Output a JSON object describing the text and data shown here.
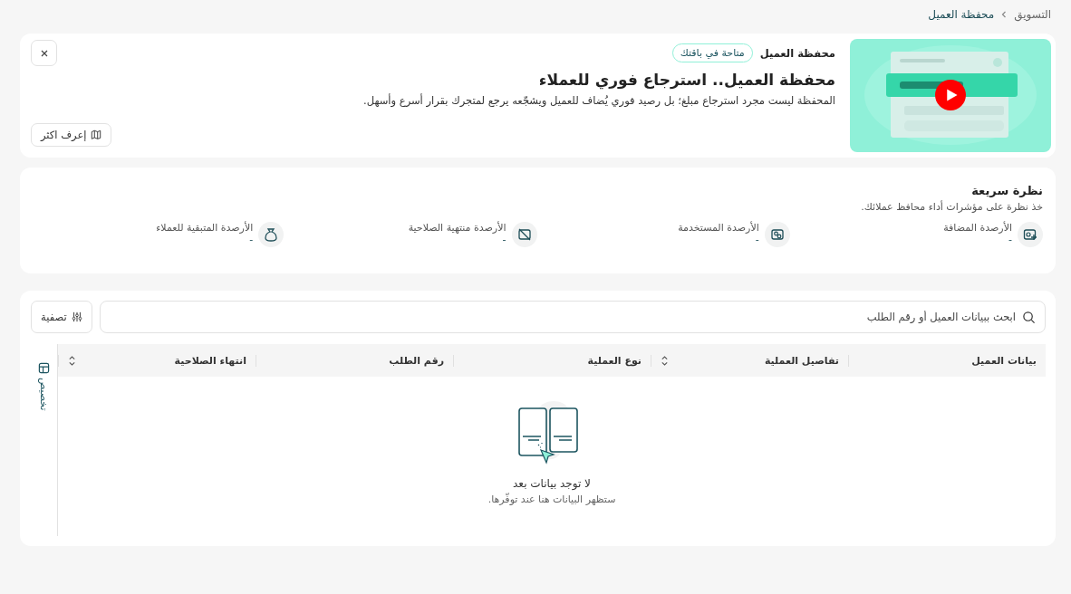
{
  "breadcrumb": [
    {
      "label": "التسويق",
      "current": false
    },
    {
      "label": "محفظة العميل",
      "current": true
    }
  ],
  "banner": {
    "kind": "picture",
    "eyebrow": "محفظة العميل",
    "badge": "متاحة في باقتك",
    "title": "محفظة العميل.. استرجاع فوري للعملاء",
    "description": "المحفظة ليست مجرد استرجاع مبلغ؛ بل رصيد فوري يُضاف للعميل ويشجّعه يرجع لمتجرك بقرار أسرع وأسهل.",
    "learn_more": "إعرف اكثر"
  },
  "overview": {
    "title": "نظرة سريعة",
    "subtitle": "خذ نظرة على مؤشرات أداء محافظ عملائك.",
    "stats": [
      {
        "kind": "added",
        "label": "الأرصدة المضافة",
        "value": "-"
      },
      {
        "kind": "used",
        "label": "الأرصدة المستخدمة",
        "value": "-"
      },
      {
        "kind": "expired",
        "label": "الأرصدة منتهية الصلاحية",
        "value": "-"
      },
      {
        "kind": "remaining",
        "label": "الأرصدة المتبقية للعملاء",
        "value": "-"
      }
    ]
  },
  "table": {
    "search_placeholder": "ابحث ببيانات العميل أو رقم الطلب",
    "filter": "تصفية",
    "customize": "تخصيص",
    "columns": [
      {
        "label": "بيانات العميل",
        "sortable": false
      },
      {
        "label": "تفاصيل العملية",
        "sortable": true
      },
      {
        "label": "نوع العملية",
        "sortable": false
      },
      {
        "label": "رقم الطلب",
        "sortable": false
      },
      {
        "label": "انتهاء الصلاحية",
        "sortable": true
      }
    ],
    "empty": {
      "title": "لا توجد بيانات بعد",
      "subtitle": "ستظهر البيانات هنا عند توفّرها."
    }
  }
}
